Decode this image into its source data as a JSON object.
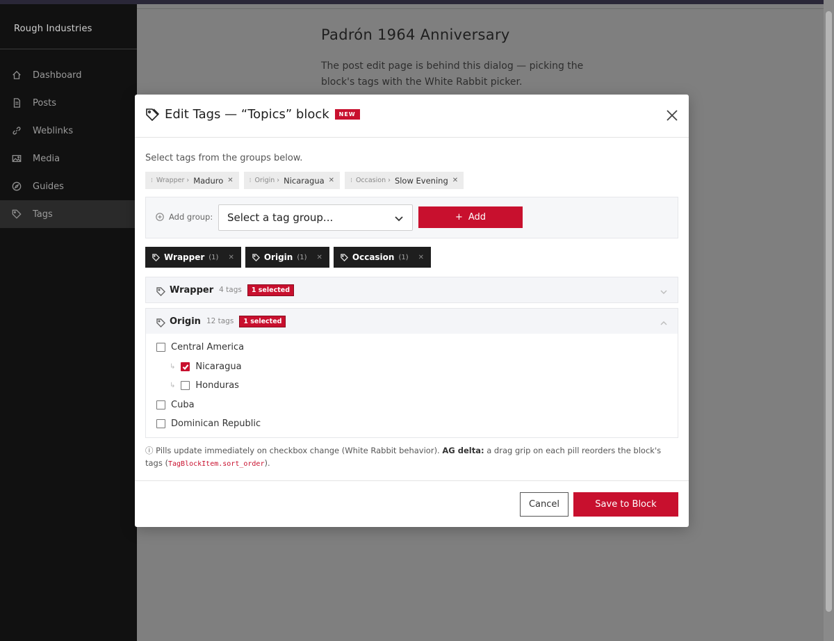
{
  "sidebar": {
    "brand": "Rough Industries",
    "items": [
      {
        "label": "Dashboard",
        "icon": "home-icon"
      },
      {
        "label": "Posts",
        "icon": "document-icon"
      },
      {
        "label": "Weblinks",
        "icon": "link-icon"
      },
      {
        "label": "Media",
        "icon": "image-icon"
      },
      {
        "label": "Guides",
        "icon": "compass-icon"
      },
      {
        "label": "Tags",
        "icon": "tag-icon",
        "active": true
      }
    ]
  },
  "page": {
    "post_title": "Padrón 1964 Anniversary",
    "post_description": "The post edit page is behind this dialog — picking the block's tags with the White Rabbit picker."
  },
  "modal": {
    "title": "Edit Tags — “Topics” block",
    "badge": "NEW",
    "instructions": "Select tags from the groups below.",
    "selected_pills": [
      {
        "group": "Wrapper ›",
        "value": "Maduro"
      },
      {
        "group": "Origin ›",
        "value": "Nicaragua"
      },
      {
        "group": "Occasion ›",
        "value": "Slow Evening"
      }
    ],
    "add_group": {
      "label": "Add group:",
      "select_value": "Select a tag group...",
      "button_label": "Add"
    },
    "group_chips": [
      {
        "name": "Wrapper",
        "count": "(1)"
      },
      {
        "name": "Origin",
        "count": "(1)"
      },
      {
        "name": "Occasion",
        "count": "(1)"
      }
    ],
    "groups": [
      {
        "name": "Wrapper",
        "count": "4 tags",
        "badge": "1 selected",
        "expanded": false
      },
      {
        "name": "Origin",
        "count": "12 tags",
        "badge": "1 selected",
        "expanded": true
      }
    ],
    "origin_tags": [
      {
        "label": "Central America",
        "checked": false,
        "child": false
      },
      {
        "label": "Nicaragua",
        "checked": true,
        "child": true
      },
      {
        "label": "Honduras",
        "checked": false,
        "child": true
      },
      {
        "label": "Cuba",
        "checked": false,
        "child": false
      },
      {
        "label": "Dominican Republic",
        "checked": false,
        "child": false
      }
    ],
    "note": {
      "icon": "ⓘ",
      "text1": "Pills update immediately on checkbox change (White Rabbit behavior).",
      "bold": "AG delta:",
      "text2": "a drag grip on each pill reorders the block's tags (",
      "code": "TagBlockItem.sort_order",
      "text3": ")."
    },
    "cancel_label": "Cancel",
    "save_label": "Save to Block"
  },
  "colors": {
    "accent": "#c8102e",
    "sidebar_bg": "#111111",
    "chip_bg": "#1e1e1e"
  }
}
